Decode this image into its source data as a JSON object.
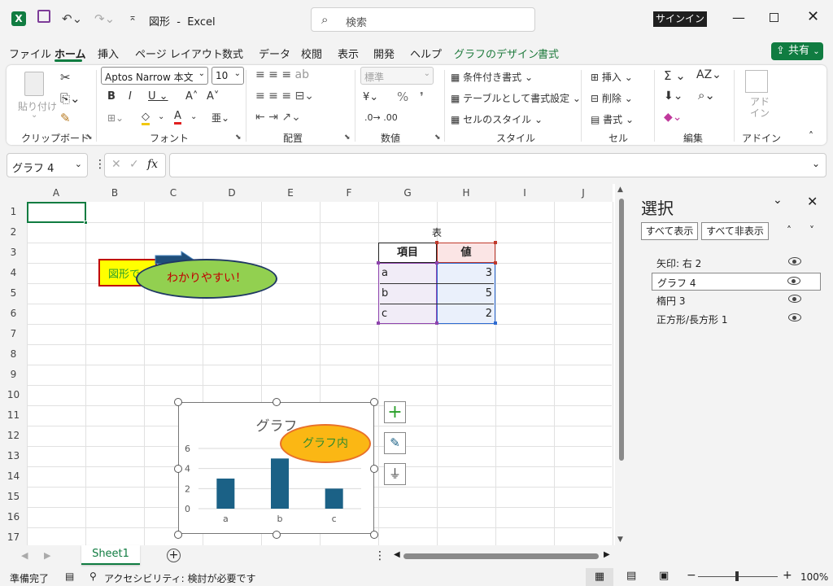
{
  "window": {
    "title": "図形  -  Excel",
    "search_placeholder": "検索",
    "signin": "サインイン"
  },
  "tabs": [
    "ファイル",
    "ホーム",
    "挿入",
    "ページ レイアウト",
    "数式",
    "データ",
    "校閲",
    "表示",
    "開発",
    "ヘルプ",
    "グラフのデザイン",
    "書式"
  ],
  "share_label": "共有",
  "ribbon": {
    "clipboard": {
      "paste": "貼り付け",
      "group": "クリップボード"
    },
    "font": {
      "name": "Aptos Narrow 本文",
      "size": "10",
      "group": "フォント"
    },
    "align": {
      "group": "配置"
    },
    "number": {
      "format": "標準",
      "group": "数値"
    },
    "styles": {
      "cond": "条件付き書式",
      "table": "テーブルとして書式設定",
      "cell": "セルのスタイル",
      "group": "スタイル"
    },
    "cells": {
      "insert": "挿入",
      "delete": "削除",
      "format": "書式",
      "group": "セル"
    },
    "edit": {
      "group": "編集"
    },
    "addin": {
      "label": "アド\nイン",
      "group": "アドイン"
    }
  },
  "formula": {
    "namebox": "グラフ 4",
    "fx": "fx",
    "value": ""
  },
  "columns": [
    "A",
    "B",
    "C",
    "D",
    "E",
    "F",
    "G",
    "H",
    "I",
    "J"
  ],
  "rows": [
    "1",
    "2",
    "3",
    "4",
    "5",
    "6",
    "7",
    "8",
    "9",
    "10",
    "11",
    "12",
    "13",
    "14",
    "15",
    "16",
    "17"
  ],
  "sheet_table": {
    "title": "表",
    "headers": [
      "項目",
      "値"
    ],
    "rows": [
      [
        "a",
        "3"
      ],
      [
        "b",
        "5"
      ],
      [
        "c",
        "2"
      ]
    ]
  },
  "shapes": {
    "rect_text": "図形で",
    "ellipse_text": "わかりやすい！"
  },
  "chart": {
    "title": "グラフ",
    "overlay_text": "グラフ内",
    "yticks": [
      "6",
      "4",
      "2",
      "0"
    ]
  },
  "chart_data": {
    "type": "bar",
    "title": "グラフ",
    "categories": [
      "a",
      "b",
      "c"
    ],
    "values": [
      3,
      5,
      2
    ],
    "ylim": [
      0,
      6
    ],
    "grid": true,
    "bar_color": "#1b6186"
  },
  "selection_pane": {
    "title": "選択",
    "show_all": "すべて表示",
    "hide_all": "すべて非表示",
    "items": [
      "矢印: 右 2",
      "グラフ 4",
      "楕円 3",
      "正方形/長方形 1"
    ],
    "selected_index": 1
  },
  "sheet_tab": "Sheet1",
  "status": {
    "ready": "準備完了",
    "accessibility": "アクセシビリティ: 検討が必要です",
    "zoom": "100%"
  },
  "colors": {
    "accent": "#1e7a3c",
    "brand": "#107c41"
  }
}
